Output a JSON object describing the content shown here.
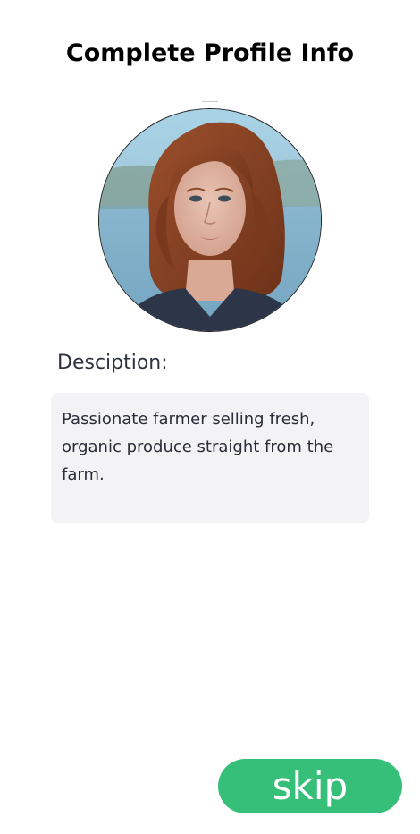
{
  "header": {
    "title": "Complete Profile Info"
  },
  "profile": {
    "avatar_icon": "profile-photo",
    "description_label": "Desciption:",
    "description_text": "Passionate farmer selling fresh, organic produce straight from the farm."
  },
  "actions": {
    "skip_label": "skip"
  },
  "colors": {
    "accent": "#36bf78",
    "text_box_bg": "#f3f3f5",
    "label_text": "#2f3340"
  }
}
